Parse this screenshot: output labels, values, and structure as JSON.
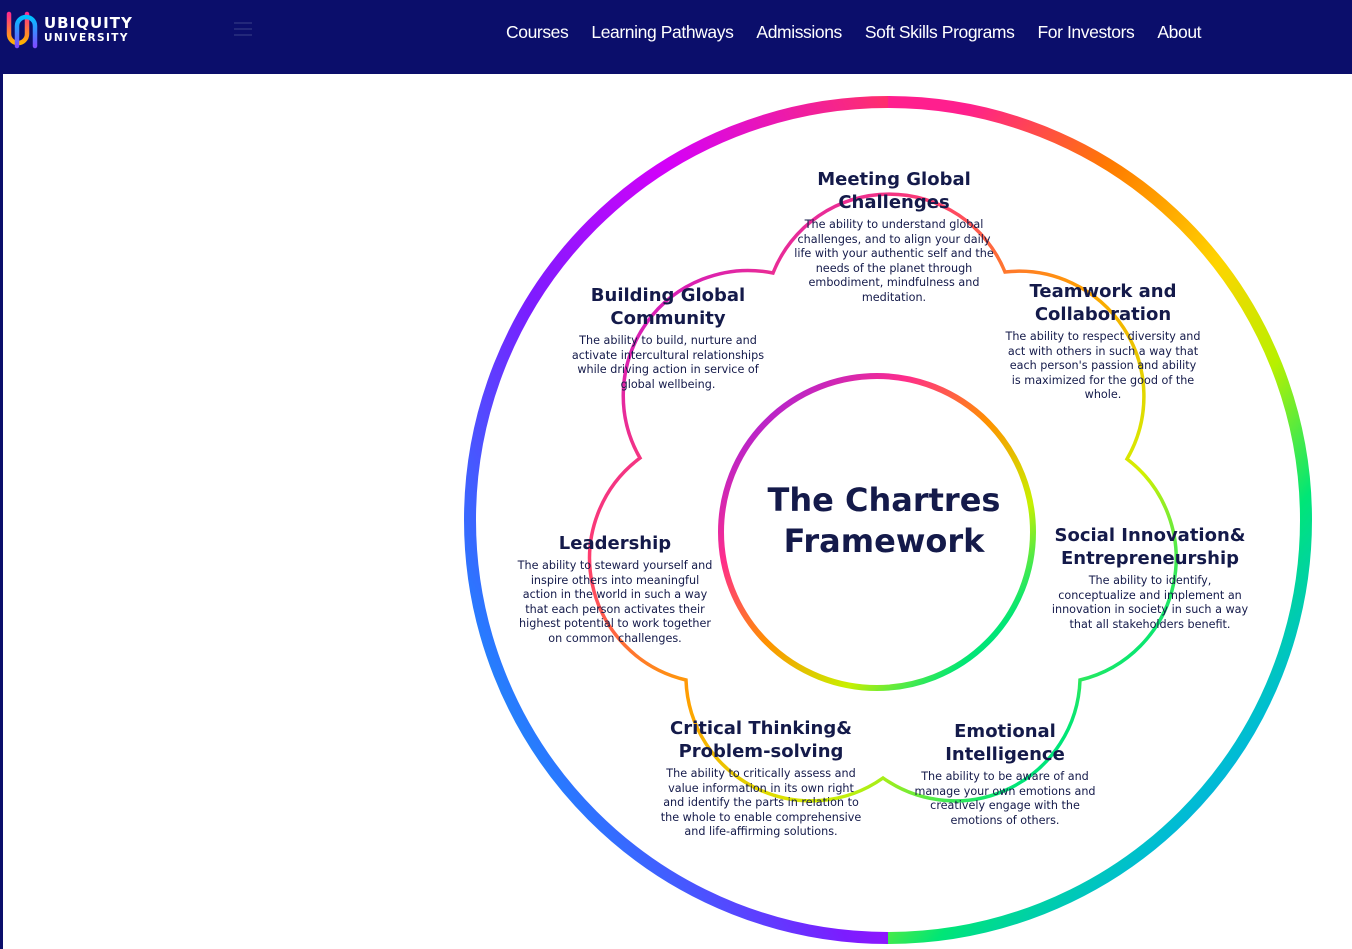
{
  "brand": {
    "name_line1": "UBIQUITY",
    "name_line2": "UNIVERSITY"
  },
  "nav": {
    "items": [
      {
        "label": "Courses"
      },
      {
        "label": "Learning Pathways"
      },
      {
        "label": "Admissions"
      },
      {
        "label": "Soft Skills Programs"
      },
      {
        "label": "For Investors"
      },
      {
        "label": "About"
      }
    ]
  },
  "icons": {
    "logo": "ubiquity-u-logo-icon",
    "menu": "hamburger-menu-icon"
  },
  "colors": {
    "nav_bg": "#0b0e6b",
    "text_dark": "#141a4a",
    "ring_gradient": [
      "#ff1f8e",
      "#ff7a00",
      "#ffd400",
      "#c8f000",
      "#00e676",
      "#00bcd4",
      "#2979ff",
      "#7c1cff",
      "#d500f9"
    ]
  },
  "framework": {
    "center_title": "The Chartres Framework",
    "petals": [
      {
        "title": "Meeting Global\nChallenges",
        "description": "The ability to understand global challenges, and to align your daily life with your authentic self and the needs of the planet through embodiment, mindfulness and meditation."
      },
      {
        "title": "Teamwork and\nCollaboration",
        "description": "The ability to respect diversity and act with others in such a way that each person's passion and ability is maximized for the good of the whole."
      },
      {
        "title": "Social Innovation&\nEntrepreneurship",
        "description": "The ability to identify, conceptualize  and implement an innovation in society in such a way that all stakeholders benefit."
      },
      {
        "title": "Emotional\nIntelligence",
        "description": "The ability to be aware of and manage your own emotions and creatively engage with the emotions of others."
      },
      {
        "title": "Critical Thinking&\nProblem-solving",
        "description": "The ability to critically assess and value information in its own right and identify the parts in relation to the whole to enable comprehensive and life-affirming solutions."
      },
      {
        "title": "Leadership",
        "description": "The ability to steward yourself and inspire others into meaningful action in the world in such a way that each person activates their highest potential to work together on common challenges."
      },
      {
        "title": "Building Global\nCommunity",
        "description": "The ability to build, nurture and activate intercultural relationships while driving action in service of global wellbeing."
      }
    ]
  }
}
